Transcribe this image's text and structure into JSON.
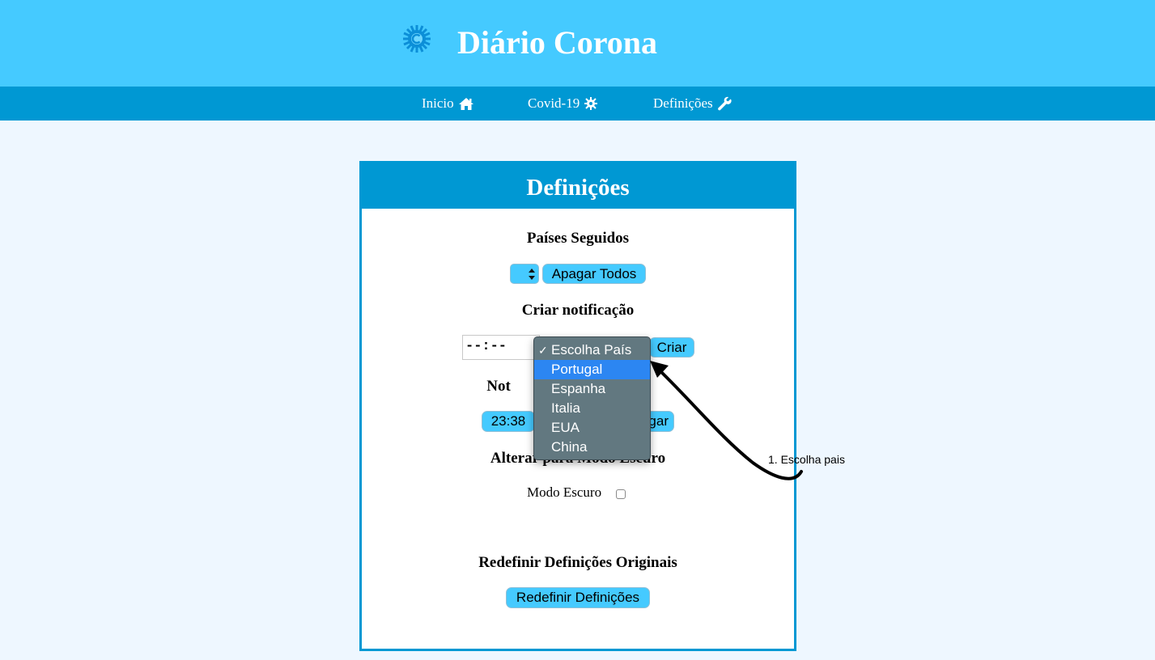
{
  "header": {
    "title": "Diário Corona"
  },
  "nav": {
    "items": [
      {
        "label": "Inicio",
        "icon": "home-icon"
      },
      {
        "label": "Covid-19",
        "icon": "virus-icon"
      },
      {
        "label": "Definições",
        "icon": "wrench-icon"
      }
    ]
  },
  "settings": {
    "title": "Definições",
    "followed": {
      "title": "Países Seguidos",
      "delete_all_label": "Apagar Todos"
    },
    "notification": {
      "title": "Criar notificação",
      "time_value": "--:--",
      "create_label": "Criar",
      "country_options": [
        "Escolha País",
        "Portugal",
        "Espanha",
        "Italia",
        "EUA",
        "China"
      ],
      "selected_option": "Escolha País",
      "highlighted_option": "Portugal"
    },
    "notifications_list": {
      "title_visible": "Not",
      "time_visible": "23:38",
      "delete_visible": "gar"
    },
    "dark_mode": {
      "title_visible": "Alterar para Modo Escuro",
      "label": "Modo Escuro",
      "checked": false
    },
    "reset": {
      "title": "Redefinir Definições Originais",
      "button_label": "Redefinir Definições"
    }
  },
  "annotation": {
    "text": "1. Escolha pais"
  },
  "colors": {
    "header": "#45caff",
    "navbar": "#0098d3",
    "background": "#eef7ff",
    "dropdown": "#627880",
    "highlight": "#2c86f2"
  }
}
